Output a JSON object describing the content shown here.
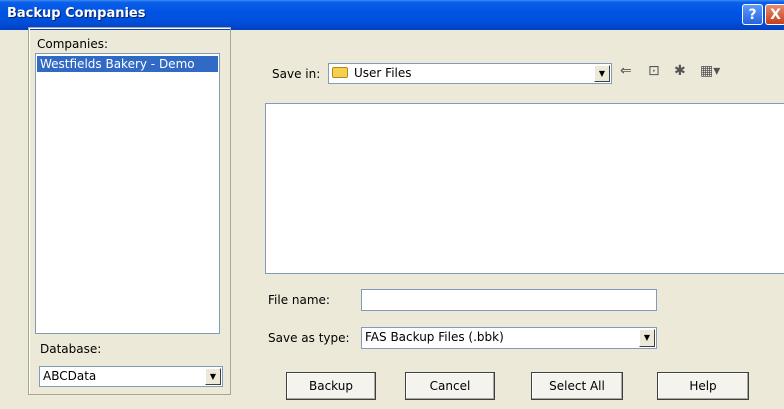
{
  "window": {
    "title": "Backup Companies",
    "help_glyph": "?",
    "close_glyph": "X"
  },
  "companies": {
    "label": "Companies:",
    "items": [
      "Westfields Bakery - Demo"
    ]
  },
  "database": {
    "label": "Database:",
    "value": "ABCData"
  },
  "save_in": {
    "label": "Save in:",
    "value": "User Files"
  },
  "toolbar": {
    "back_glyph": "⇐",
    "up_glyph": "⊡",
    "newfolder_glyph": "✱",
    "views_glyph": "▦▾"
  },
  "file_name": {
    "label": "File name:",
    "value": ""
  },
  "save_as_type": {
    "label": "Save as type:",
    "value": "FAS Backup Files (.bbk)"
  },
  "buttons": {
    "backup": "Backup",
    "cancel": "Cancel",
    "select_all": "Select All",
    "help": "Help"
  },
  "colors": {
    "titlebar": "#0054e3",
    "selection": "#316ac5",
    "dialog_bg": "#ece9d8"
  }
}
